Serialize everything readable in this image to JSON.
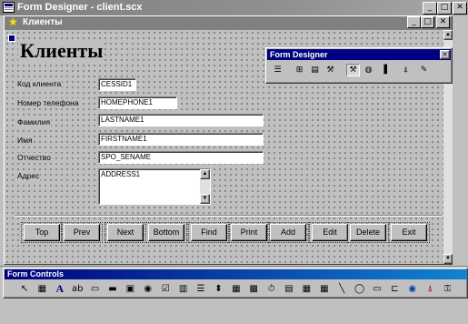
{
  "window": {
    "title": "Form Designer - client.scx"
  },
  "form": {
    "title": "Клиенты",
    "heading": "Клиенты",
    "labels": {
      "code": "Код клиента",
      "phone": "Номер телефона",
      "surname": "Фамилия",
      "name": "Имя",
      "patronymic": "Отчество",
      "address": "Адрес"
    },
    "fields": {
      "code": "CESSID1",
      "phone": "HOMEPHONE1",
      "surname": "LASTNAME1",
      "name": "FIRSTNAME1",
      "patronymic": "SPO_SENAME",
      "address": "ADDRESS1"
    },
    "buttons": [
      "Top",
      "Prev",
      "Next",
      "Bottom",
      "Find",
      "Print",
      "Add",
      "Edit",
      "Delete",
      "Exit"
    ]
  },
  "toolbars": {
    "designer_title": "Form Designer",
    "controls_title": "Form Controls"
  },
  "colors": {
    "titlebar_active": "#000080",
    "titlebar_inactive": "#808080",
    "face": "#c0c0c0"
  }
}
